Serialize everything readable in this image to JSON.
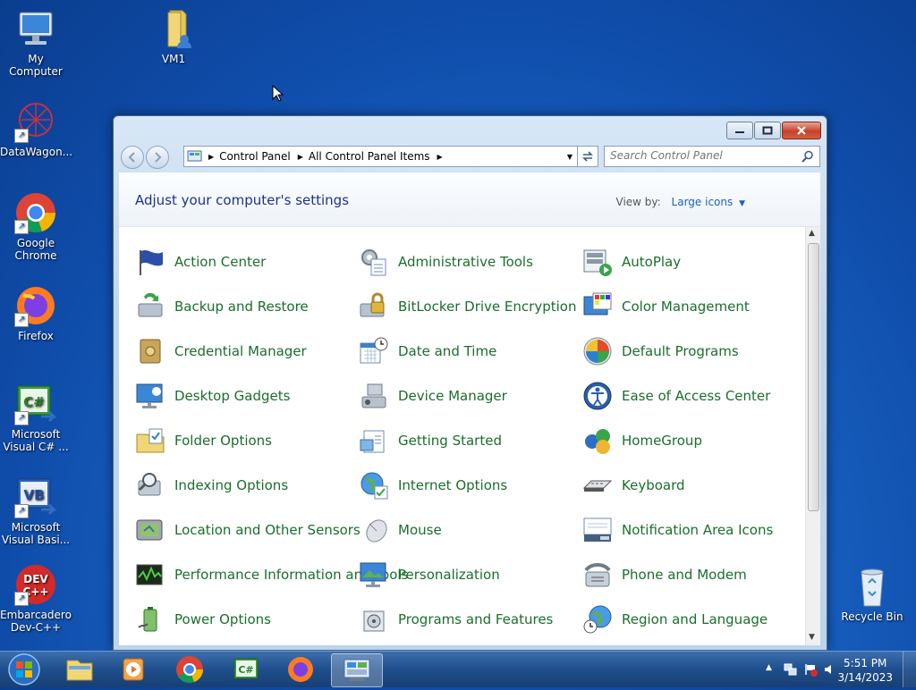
{
  "desktop": {
    "icons": [
      {
        "label": "My Computer"
      },
      {
        "label": "VM1"
      },
      {
        "label": "DataWagon..."
      },
      {
        "label": "Google Chrome"
      },
      {
        "label": "Firefox"
      },
      {
        "label": "Microsoft Visual C# ..."
      },
      {
        "label": "Microsoft Visual Basi..."
      },
      {
        "label": "Embarcadero Dev-C++"
      },
      {
        "label": "Recycle Bin"
      }
    ]
  },
  "window": {
    "breadcrumb": [
      "Control Panel",
      "All Control Panel Items"
    ],
    "search_placeholder": "Search Control Panel",
    "header_title": "Adjust your computer's settings",
    "view_by_label": "View by:",
    "view_by_value": "Large icons",
    "items": [
      {
        "label": "Action Center"
      },
      {
        "label": "Administrative Tools"
      },
      {
        "label": "AutoPlay"
      },
      {
        "label": "Backup and Restore"
      },
      {
        "label": "BitLocker Drive Encryption"
      },
      {
        "label": "Color Management"
      },
      {
        "label": "Credential Manager"
      },
      {
        "label": "Date and Time"
      },
      {
        "label": "Default Programs"
      },
      {
        "label": "Desktop Gadgets"
      },
      {
        "label": "Device Manager"
      },
      {
        "label": "Ease of Access Center"
      },
      {
        "label": "Folder Options"
      },
      {
        "label": "Getting Started"
      },
      {
        "label": "HomeGroup"
      },
      {
        "label": "Indexing Options"
      },
      {
        "label": "Internet Options"
      },
      {
        "label": "Keyboard"
      },
      {
        "label": "Location and Other Sensors"
      },
      {
        "label": "Mouse"
      },
      {
        "label": "Notification Area Icons"
      },
      {
        "label": "Performance Information and Tools"
      },
      {
        "label": "Personalization"
      },
      {
        "label": "Phone and Modem"
      },
      {
        "label": "Power Options"
      },
      {
        "label": "Programs and Features"
      },
      {
        "label": "Region and Language"
      }
    ]
  },
  "taskbar": {
    "time": "5:51 PM",
    "date": "3/14/2023"
  }
}
